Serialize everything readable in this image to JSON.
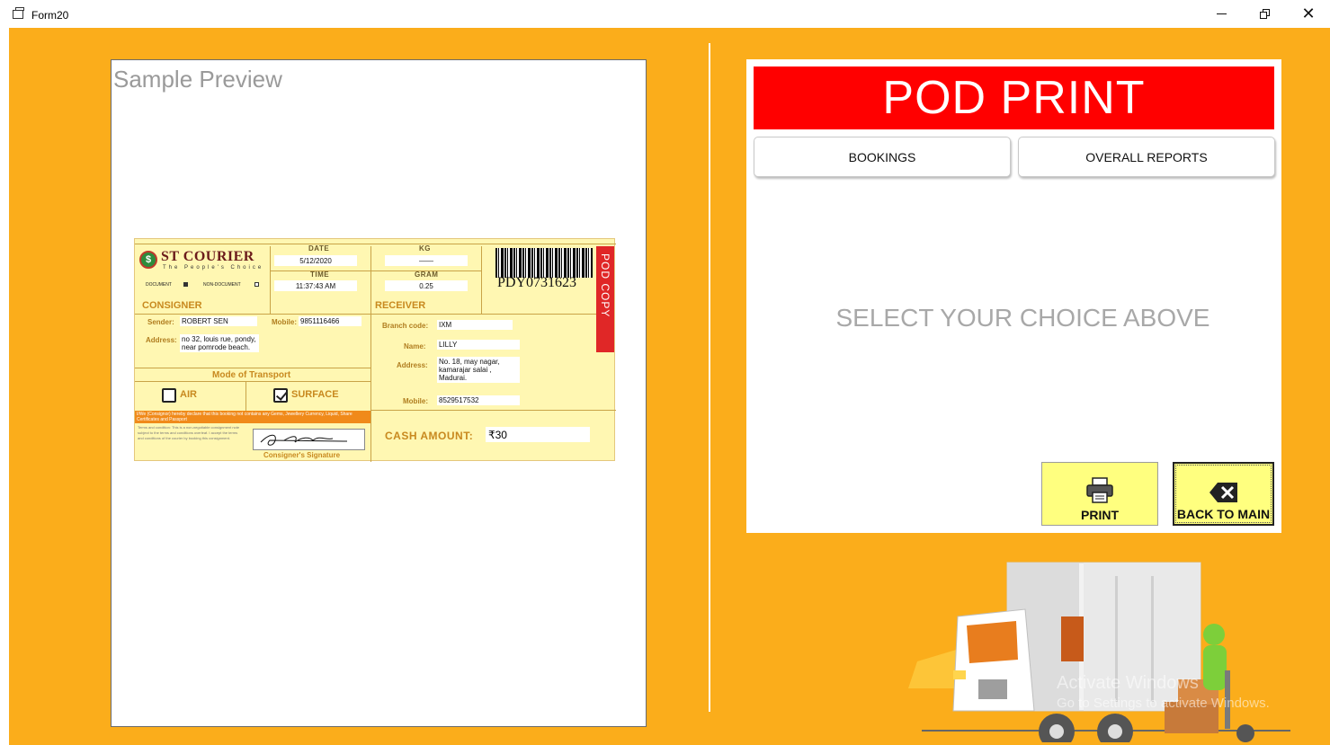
{
  "window": {
    "title": "Form20",
    "controls": {
      "minimize": "minimize",
      "maximize": "restore",
      "close": "close"
    }
  },
  "preview": {
    "title": "Sample Preview",
    "pod_slip": {
      "brand": "ST COURIER",
      "tagline": "The People's Choice",
      "date_label": "DATE",
      "date": "5/12/2020",
      "time_label": "TIME",
      "time": "11:37:43 AM",
      "kg_label": "KG",
      "kg": "——",
      "gram_label": "GRAM",
      "gram": "0.25",
      "document_label": "DOCUMENT",
      "non_document_label": "NON-DOCUMENT",
      "document_checked": true,
      "tracking_number": "PDY0731623",
      "pod_copy_label": "POD COPY",
      "consigner_heading": "CONSIGNER",
      "sender_label": "Sender:",
      "sender": "ROBERT SEN",
      "sender_mobile_label": "Mobile:",
      "sender_mobile": "9851116466",
      "sender_address_label": "Address:",
      "sender_address": "no 32, louis rue, pondy, near pomrode beach.",
      "receiver_heading": "RECEIVER",
      "branch_label": "Branch code:",
      "branch": "IXM",
      "name_label": "Name:",
      "name": "LILLY",
      "receiver_address_label": "Address:",
      "receiver_address": "No. 18, may nagar, kamarajar salai , Madurai.",
      "receiver_mobile_label": "Mobile:",
      "receiver_mobile": "8529517532",
      "transport_heading": "Mode of Transport",
      "air_label": "AIR",
      "surface_label": "SURFACE",
      "air_checked": false,
      "surface_checked": true,
      "declaration": "I/We (Consignor) hereby declare that this booking not contains any Gems, Jewellery Currency, Liquid, Share Certificates and Passport",
      "terms": "Terms and condition: This is a non-negotiable consignment note subject to the terms and conditions overleaf. I accept the terms and conditions of the courier by booking this consignment.",
      "signature_label": "Consigner's Signature",
      "cash_label": "CASH AMOUNT:",
      "cash_value": "₹30"
    }
  },
  "panel": {
    "banner": "POD PRINT",
    "tabs": {
      "bookings": "BOOKINGS",
      "reports": "OVERALL REPORTS"
    },
    "prompt": "SELECT YOUR CHOICE ABOVE",
    "print_label": "PRINT",
    "back_label": "BACK TO MAIN"
  },
  "watermark": {
    "line1": "Activate Windows",
    "line2": "Go to Settings to activate Windows."
  },
  "colors": {
    "background": "#fbad1b",
    "banner": "#ff0000",
    "action_button": "#ffff7f",
    "slip": "#fff7b2"
  },
  "icons": {
    "print": "printer-icon",
    "back": "backspace-icon",
    "truck": "delivery-truck-illustration"
  }
}
